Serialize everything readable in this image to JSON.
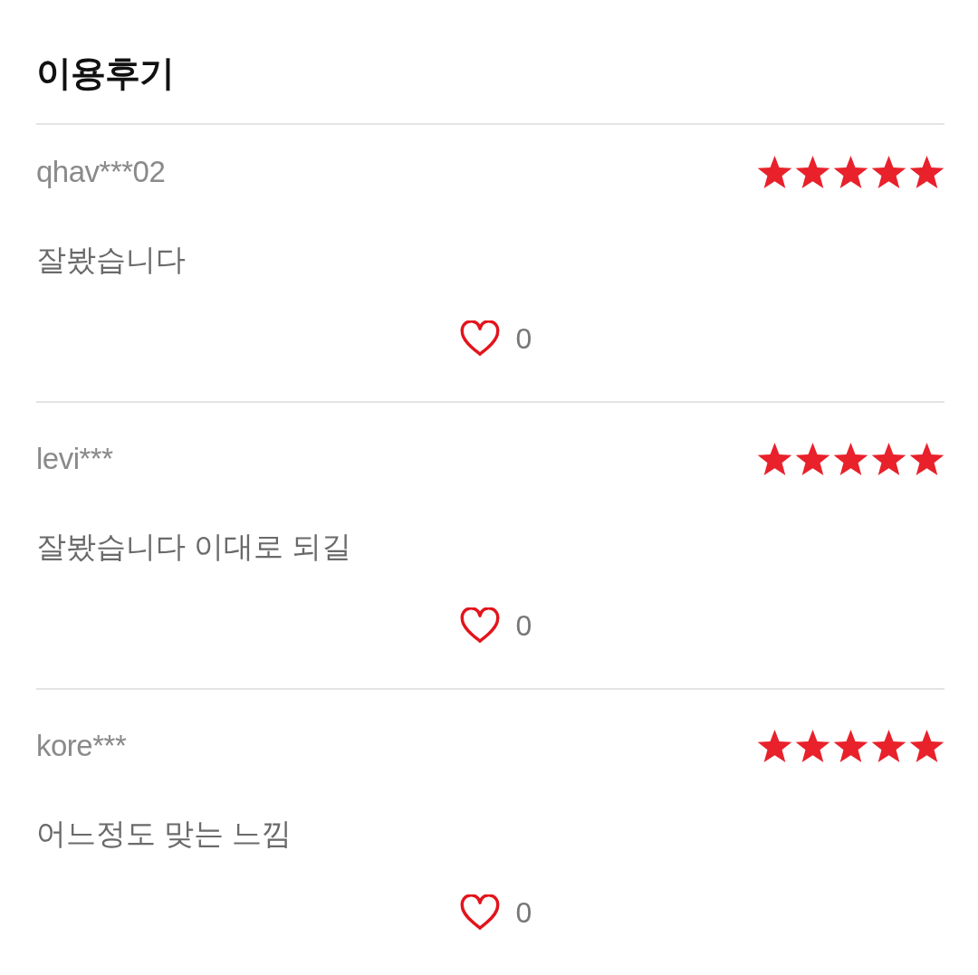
{
  "title": "이용후기",
  "reviews": [
    {
      "user": "qhav***02",
      "stars": 5,
      "text": "잘봤습니다",
      "likes": "0"
    },
    {
      "user": "levi***",
      "stars": 5,
      "text": "잘봤습니다 이대로 되길",
      "likes": "0"
    },
    {
      "user": "kore***",
      "stars": 5,
      "text": "어느정도 맞는 느낌",
      "likes": "0"
    }
  ]
}
